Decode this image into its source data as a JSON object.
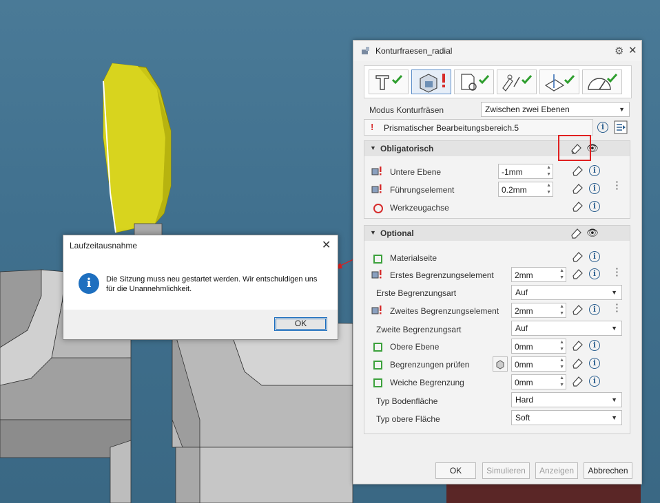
{
  "panel": {
    "title": "Konturfraesen_radial",
    "mode_label": "Modus Konturfräsen",
    "mode_value": "Zwischen zwei Ebenen",
    "warning_mark": "!",
    "warning_text": "Prismatischer Bearbeitungsbereich.5",
    "sections": {
      "mandatory": {
        "title": "Obligatorisch",
        "rows": [
          {
            "label": "Untere Ebene",
            "value": "-1mm"
          },
          {
            "label": "Führungselement",
            "value": "0.2mm"
          },
          {
            "label": "Werkzeugachse"
          }
        ]
      },
      "optional": {
        "title": "Optional",
        "rows": [
          {
            "label": "Materialseite"
          },
          {
            "label": "Erstes Begrenzungselement",
            "value": "2mm"
          },
          {
            "label": "Erste Begrenzungsart",
            "value": "Auf"
          },
          {
            "label": "Zweites Begrenzungselement",
            "value": "2mm"
          },
          {
            "label": "Zweite Begrenzungsart",
            "value": "Auf"
          },
          {
            "label": "Obere Ebene",
            "value": "0mm"
          },
          {
            "label": "Begrenzungen prüfen",
            "value": "0mm"
          },
          {
            "label": "Weiche Begrenzung",
            "value": "0mm"
          },
          {
            "label": "Typ Bodenfläche",
            "value": "Hard"
          },
          {
            "label": "Typ obere Fläche",
            "value": "Soft"
          }
        ]
      }
    },
    "buttons": {
      "ok": "OK",
      "simulate": "Simulieren",
      "show": "Anzeigen",
      "cancel": "Abbrechen"
    }
  },
  "dialog": {
    "title": "Laufzeitausnahme",
    "message": "Die Sitzung muss neu gestartet werden. Wir entschuldigen uns für die Unannehmlichkeit.",
    "ok": "OK"
  },
  "colors": {
    "accent": "#1e6fbf",
    "ok": "#3ca13c",
    "error": "#d62b2b",
    "part": "#d6d21a"
  }
}
